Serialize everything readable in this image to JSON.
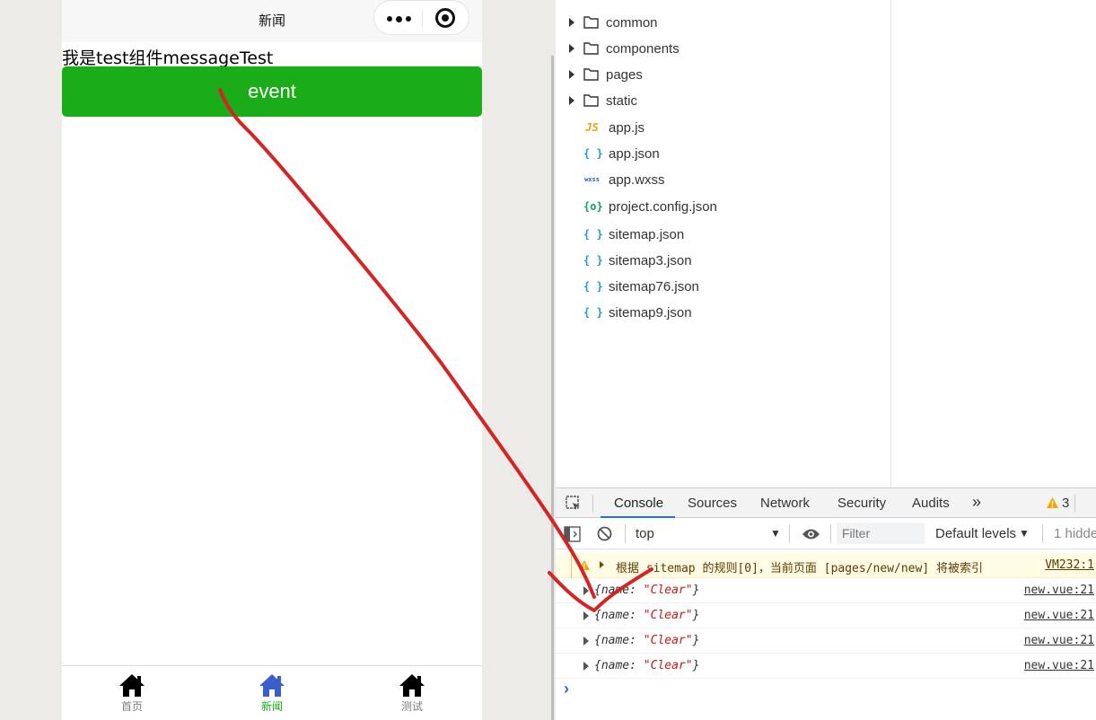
{
  "phone": {
    "nav_title": "新闻",
    "message_text": "我是test组件messageTest",
    "event_button_label": "event",
    "tabs": [
      {
        "label": "首页",
        "icon": "home-icon",
        "active": false
      },
      {
        "label": "新闻",
        "icon": "home-icon",
        "active": true
      },
      {
        "label": "测试",
        "icon": "home-icon",
        "active": false
      }
    ]
  },
  "file_tree": {
    "folders": [
      "common",
      "components",
      "pages",
      "static"
    ],
    "files": [
      {
        "name": "app.js",
        "icon": "JS",
        "icon_name": "js-file-icon"
      },
      {
        "name": "app.json",
        "icon": "{ }",
        "icon_name": "json-file-icon"
      },
      {
        "name": "app.wxss",
        "icon": "wxss",
        "icon_name": "wxss-file-icon"
      },
      {
        "name": "project.config.json",
        "icon": "{o}",
        "icon_name": "config-file-icon"
      },
      {
        "name": "sitemap.json",
        "icon": "{ }",
        "icon_name": "json-file-icon"
      },
      {
        "name": "sitemap3.json",
        "icon": "{ }",
        "icon_name": "json-file-icon"
      },
      {
        "name": "sitemap76.json",
        "icon": "{ }",
        "icon_name": "json-file-icon"
      },
      {
        "name": "sitemap9.json",
        "icon": "{ }",
        "icon_name": "json-file-icon"
      }
    ]
  },
  "devtools": {
    "tabs": [
      "Console",
      "Sources",
      "Network",
      "Security",
      "Audits"
    ],
    "more_tabs": "»",
    "warning_count": "3",
    "context": "top",
    "filter_placeholder": "Filter",
    "levels": "Default levels",
    "hidden": "1 hidde",
    "warning": {
      "text": "根据 sitemap 的规则[0]，当前页面 [pages/new/new] 将被索引",
      "source": "VM232:1"
    },
    "logs": [
      {
        "key": "name",
        "value": "\"Clear\"",
        "source": "new.vue:21"
      },
      {
        "key": "name",
        "value": "\"Clear\"",
        "source": "new.vue:21"
      },
      {
        "key": "name",
        "value": "\"Clear\"",
        "source": "new.vue:21"
      },
      {
        "key": "name",
        "value": "\"Clear\"",
        "source": "new.vue:21"
      }
    ],
    "prompt": "›"
  },
  "colors": {
    "button_green": "#1aad19",
    "tab_active": "#1aad19",
    "home_icon_active": "#3a5fcd",
    "console_accent": "#1a73e8",
    "annotation_red": "#d52424",
    "warning_bg": "#fffbe5"
  }
}
